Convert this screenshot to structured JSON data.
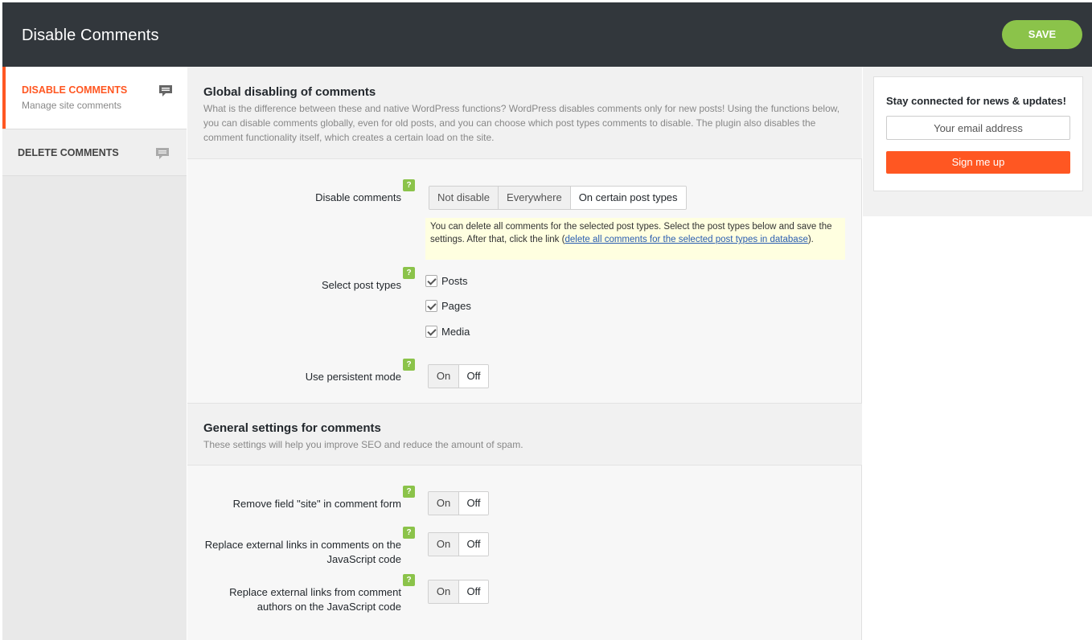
{
  "header": {
    "title": "Disable Comments",
    "save_label": "SAVE"
  },
  "sidebar": {
    "items": [
      {
        "label": "DISABLE COMMENTS",
        "sub": "Manage site comments",
        "icon": "comment-icon"
      },
      {
        "label": "DELETE COMMENTS",
        "icon": "comment-icon"
      }
    ]
  },
  "main": {
    "section1": {
      "title": "Global disabling of comments",
      "description": "What is the difference between these and native WordPress functions? WordPress disables comments only for new posts! Using the functions below, you can disable comments globally, even for old posts, and you can choose which post types comments to disable. The plugin also disables the comment functionality itself, which creates a certain load on the site."
    },
    "disable_comments": {
      "label": "Disable comments",
      "options": [
        "Not disable",
        "Everywhere",
        "On certain post types"
      ],
      "selected": "On certain post types",
      "notice_before": "You can delete all comments for the selected post types. Select the post types below and save the settings. After that, click the link (",
      "notice_link": "delete all comments for the selected post types in database",
      "notice_after": ")."
    },
    "post_types": {
      "label": "Select post types",
      "items": [
        {
          "label": "Posts",
          "checked": true
        },
        {
          "label": "Pages",
          "checked": true
        },
        {
          "label": "Media",
          "checked": true
        }
      ]
    },
    "persistent_mode": {
      "label": "Use persistent mode",
      "on": "On",
      "off": "Off",
      "selected": "Off"
    },
    "section2": {
      "title": "General settings for comments",
      "description": "These settings will help you improve SEO and reduce the amount of spam."
    },
    "remove_site_field": {
      "label": "Remove field \"site\" in comment form",
      "on": "On",
      "off": "Off",
      "selected": "Off"
    },
    "replace_links_comments": {
      "label_line1": "Replace external links in comments on the",
      "label_line2": "JavaScript code",
      "on": "On",
      "off": "Off",
      "selected": "Off"
    },
    "replace_links_authors": {
      "label_line1": "Replace external links from comment",
      "label_line2": "authors on the JavaScript code",
      "on": "On",
      "off": "Off",
      "selected": "Off"
    },
    "help_label": "?"
  },
  "newsletter": {
    "title": "Stay connected for news & updates!",
    "email_placeholder": "Your email address",
    "signup_label": "Sign me up"
  },
  "colors": {
    "header_bg": "#32373c",
    "accent_orange": "#ff5722",
    "accent_green": "#8bc34a"
  }
}
